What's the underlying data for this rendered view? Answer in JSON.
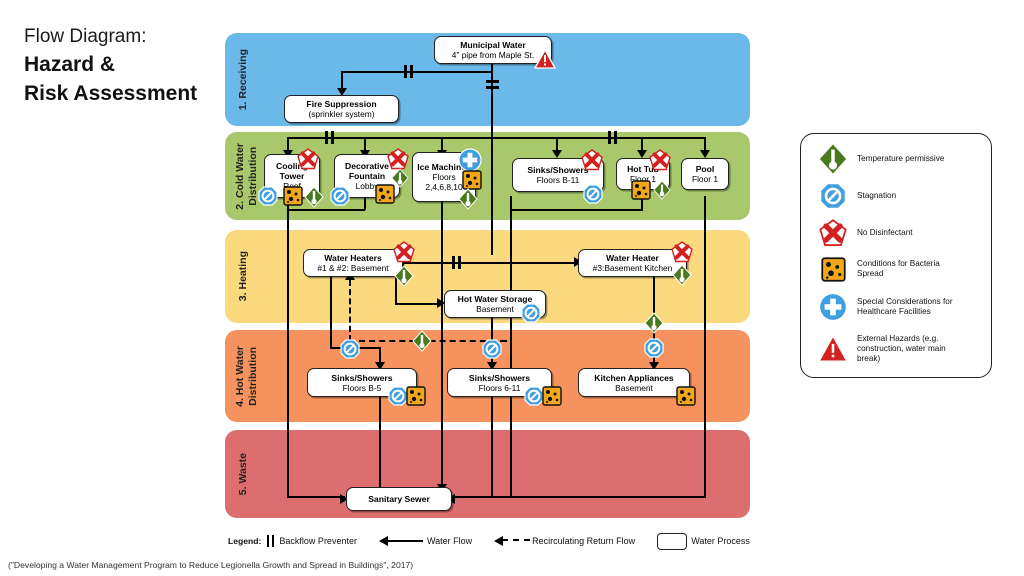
{
  "header": {
    "line1": "Flow Diagram:",
    "line2": "Hazard &",
    "line3": "Risk Assessment"
  },
  "citation": "(\"Developing a Water Management Program to Reduce Legionella Growth and Spread in Buildings\", 2017)",
  "bands": [
    {
      "id": "receiving",
      "label": "1. Receiving",
      "color": "#6BB9E8"
    },
    {
      "id": "cold",
      "label": "2. Cold Water\nDistribution",
      "color": "#A8C86B"
    },
    {
      "id": "heating",
      "label": "3. Heating",
      "color": "#FAD97F"
    },
    {
      "id": "hotwater",
      "label": "4. Hot Water\nDistribution",
      "color": "#F5925E"
    },
    {
      "id": "waste",
      "label": "5. Waste",
      "color": "#DD6E70"
    }
  ],
  "band_labels": {
    "receiving": "1. Receiving",
    "cold_l1": "2. Cold Water",
    "cold_l2": "Distribution",
    "heating": "3. Heating",
    "hot_l1": "4. Hot Water",
    "hot_l2": "Distribution",
    "waste": "5. Waste"
  },
  "nodes": {
    "municipal_water": {
      "title": "Municipal Water",
      "sub": "4” pipe from Maple St."
    },
    "fire_suppression": {
      "title": "Fire Suppression",
      "sub": "(sprinkler system)"
    },
    "cooling_tower": {
      "title": "Cooling Tower",
      "sub": "Roof"
    },
    "decorative_fountain": {
      "title": "Decorative Fountain",
      "sub": "Lobby"
    },
    "ice_machines": {
      "title": "Ice Machines",
      "sub": "Floors 2,4,6,8,10"
    },
    "sinks_showers_cold": {
      "title": "Sinks/Showers",
      "sub": "Floors B-11"
    },
    "hot_tub": {
      "title": "Hot Tub",
      "sub": "Floor 1"
    },
    "pool": {
      "title": "Pool",
      "sub": "Floor 1"
    },
    "water_heaters_12": {
      "title": "Water Heaters",
      "sub": "#1 & #2: Basement"
    },
    "water_heater_3": {
      "title": "Water Heater",
      "sub": "#3:Basement Kitchen"
    },
    "hot_water_storage": {
      "title": "Hot Water Storage",
      "sub": "Basement"
    },
    "sinks_showers_b5": {
      "title": "Sinks/Showers",
      "sub": "Floors B-5"
    },
    "sinks_showers_611": {
      "title": "Sinks/Showers",
      "sub": "Floors 6-11"
    },
    "kitchen_appliances": {
      "title": "Kitchen Appliances",
      "sub": "Basement"
    },
    "sanitary_sewer": {
      "title": "Sanitary Sewer",
      "sub": ""
    }
  },
  "hazard_legend": {
    "title": "",
    "items": [
      {
        "icon": "temperature-permissive-icon",
        "label": "Temperature permissive",
        "color": "#4A7A1E"
      },
      {
        "icon": "stagnation-icon",
        "label": "Stagnation",
        "color": "#3F9FE0"
      },
      {
        "icon": "no-disinfectant-icon",
        "label": "No Disinfectant",
        "color": "#D32020"
      },
      {
        "icon": "bacteria-spread-icon",
        "label": "Conditions for Bacteria Spread",
        "color": "#F0A game"
      },
      {
        "icon": "healthcare-icon",
        "label": "Special Considerations for Healthcare Facilities",
        "color": "#3F9FE0"
      },
      {
        "icon": "external-hazard-icon",
        "label": "External Hazards (e.g. construction, water main break)",
        "color": "#D32020"
      }
    ]
  },
  "hazard_legend_text": {
    "i0": "Temperature permissive",
    "i1": "Stagnation",
    "i2": "No Disinfectant",
    "i3a": "Conditions for Bacteria",
    "i3b": "Spread",
    "i4a": "Special Considerations for",
    "i4b": "Healthcare Facilities",
    "i5a": "External Hazards (e.g.",
    "i5b": "construction, water main",
    "i5c": "break)"
  },
  "bottom_legend": {
    "label": "Legend:",
    "backflow_preventer": "Backflow Preventer",
    "water_flow": "Water Flow",
    "recirculating_return_flow": "Recirculating Return Flow",
    "water_process": "Water Process"
  },
  "colors": {
    "band_receiving": "#6BB9E8",
    "band_cold": "#A8C86B",
    "band_heating": "#FAD97F",
    "band_hotwater": "#F5925E",
    "band_waste": "#DD6E70",
    "icon_green": "#4A7A1E",
    "icon_blue": "#3F9FE0",
    "icon_red": "#D32020",
    "icon_orange": "#F2A71B",
    "line": "#000000"
  }
}
